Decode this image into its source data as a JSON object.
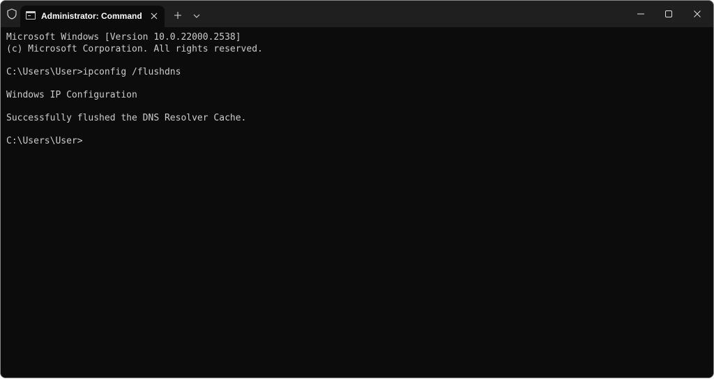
{
  "titlebar": {
    "tab": {
      "title": "Administrator: Command Pro",
      "icon": "terminal-icon"
    },
    "icons": {
      "shield": "shield-icon",
      "close_tab": "close-icon",
      "new_tab": "plus-icon",
      "dropdown": "chevron-down-icon",
      "minimize": "minimize-icon",
      "maximize": "maximize-icon",
      "close_window": "close-icon"
    }
  },
  "terminal": {
    "lines": [
      "Microsoft Windows [Version 10.0.22000.2538]",
      "(c) Microsoft Corporation. All rights reserved.",
      "",
      "C:\\Users\\User>ipconfig /flushdns",
      "",
      "Windows IP Configuration",
      "",
      "Successfully flushed the DNS Resolver Cache.",
      "",
      "C:\\Users\\User>"
    ]
  },
  "colors": {
    "titlebar_bg": "#1f1f1f",
    "terminal_bg": "#0c0c0c",
    "text": "#cccccc",
    "tab_title": "#ffffff"
  }
}
